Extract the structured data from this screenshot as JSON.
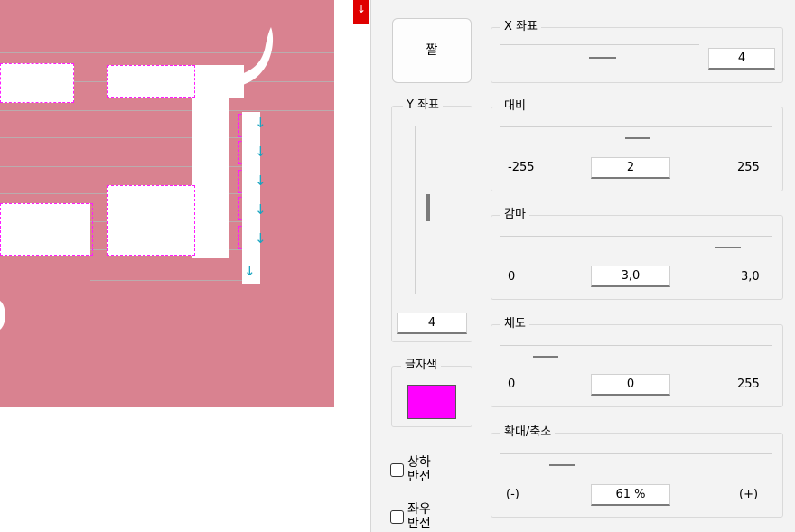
{
  "canvas": {
    "background": "#d98290",
    "glyph_color": "#ffffff",
    "guide_color": "#ff1bff",
    "arrow_color": "#17a4c0",
    "arrow_glyph": "↓",
    "partial_glyph": "0",
    "marker_glyph": "↓"
  },
  "panel": {
    "top_button": {
      "label": "짤"
    },
    "x_coord": {
      "label": "X 좌표",
      "value": "4"
    },
    "y_coord": {
      "label": "Y 좌표",
      "value": "4"
    },
    "contrast": {
      "label": "대비",
      "min": "-255",
      "value": "2",
      "max": "255"
    },
    "gamma": {
      "label": "감마",
      "min": "0",
      "value": "3,0",
      "max": "3,0"
    },
    "saturation": {
      "label": "채도",
      "min": "0",
      "value": "0",
      "max": "255"
    },
    "zoom": {
      "label": "확대/축소",
      "min": "(-)",
      "value": "61 %",
      "max": "(+)"
    },
    "text_color": {
      "label": "글자색",
      "color": "#ff00ff"
    },
    "flip_vertical": {
      "label_line1": "상하",
      "label_line2": "반전",
      "checked": false
    },
    "flip_horizontal": {
      "label_line1": "좌우",
      "label_line2": "반전",
      "checked": false
    }
  }
}
